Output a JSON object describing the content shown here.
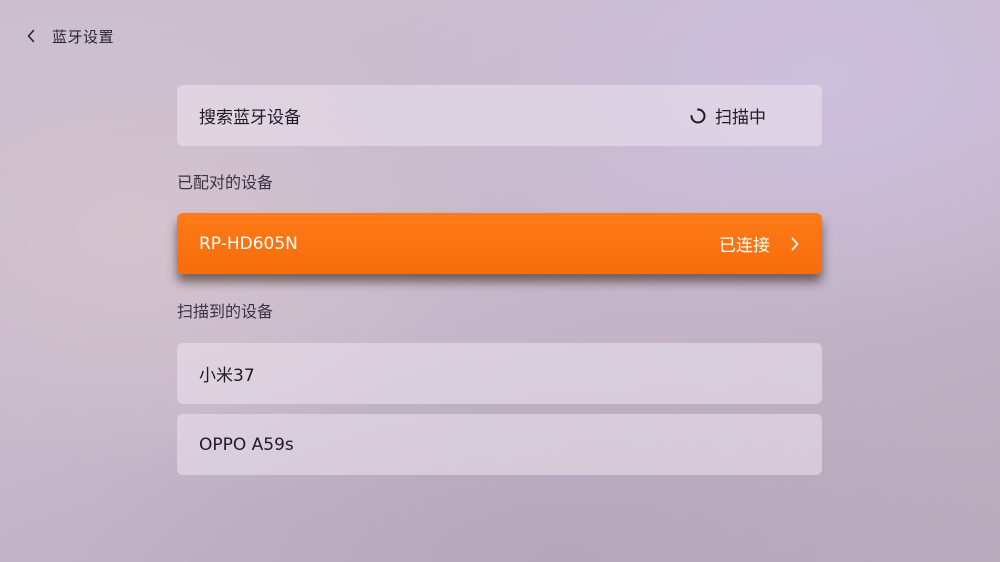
{
  "header": {
    "back_icon": "chevron-left-icon",
    "title": "蓝牙设置"
  },
  "search_row": {
    "label": "搜索蓝牙设备",
    "status_icon": "spinner-icon",
    "status": "扫描中"
  },
  "paired_section": {
    "label": "已配对的设备",
    "devices": [
      {
        "name": "RP-HD605N",
        "status": "已连接",
        "icon": "chevron-right-icon",
        "focused": true
      }
    ]
  },
  "scanned_section": {
    "label": "扫描到的设备",
    "devices": [
      {
        "name": "小米37"
      },
      {
        "name": "OPPO A59s"
      }
    ]
  },
  "colors": {
    "accent": "#FF7A18",
    "row_bg": "#ECE4EE",
    "text": "#1F1B24"
  }
}
